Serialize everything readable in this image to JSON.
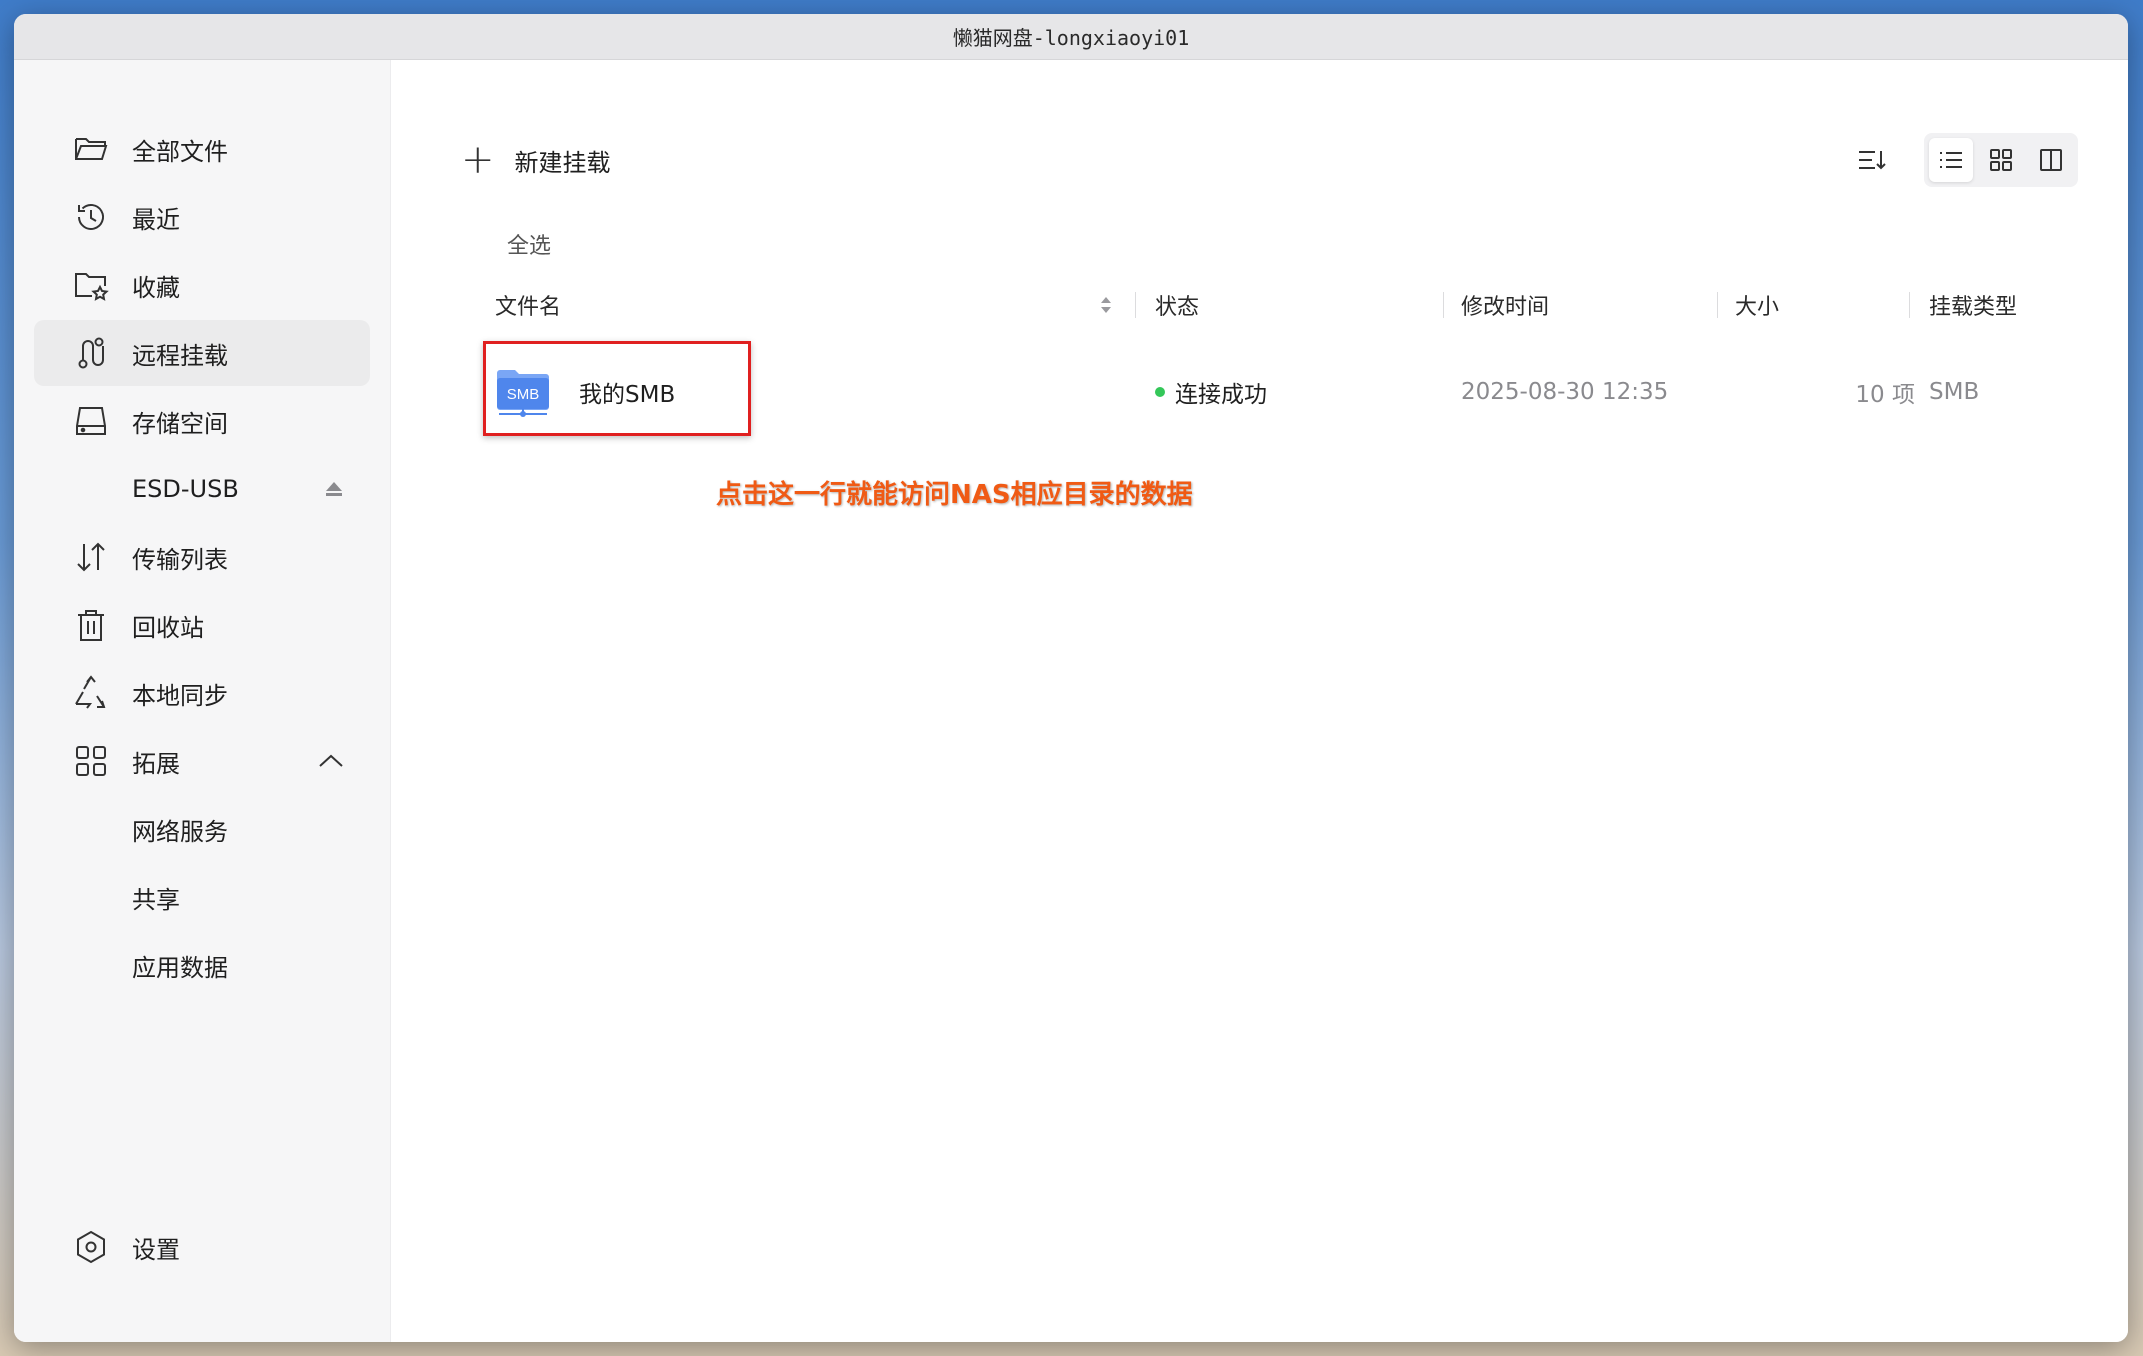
{
  "window": {
    "title": "懒猫网盘-longxiaoyi01"
  },
  "sidebar": {
    "items": [
      {
        "label": "全部文件",
        "icon": "folder-open-icon"
      },
      {
        "label": "最近",
        "icon": "history-icon"
      },
      {
        "label": "收藏",
        "icon": "folder-star-icon"
      },
      {
        "label": "远程挂载",
        "icon": "remote-mount-icon",
        "active": true
      },
      {
        "label": "存储空间",
        "icon": "hard-drive-icon"
      },
      {
        "label": "ESD-USB",
        "icon": "eject-icon"
      },
      {
        "label": "传输列表",
        "icon": "transfer-icon"
      },
      {
        "label": "回收站",
        "icon": "trash-icon"
      },
      {
        "label": "本地同步",
        "icon": "sync-icon"
      },
      {
        "label": "拓展",
        "icon": "grid-apps-icon"
      },
      {
        "label": "网络服务"
      },
      {
        "label": "共享"
      },
      {
        "label": "应用数据"
      }
    ],
    "settings": {
      "label": "设置",
      "icon": "settings-icon"
    }
  },
  "toolbar": {
    "new_mount_label": "新建挂载"
  },
  "list": {
    "select_all_label": "全选",
    "columns": {
      "name": "文件名",
      "status": "状态",
      "modified": "修改时间",
      "size": "大小",
      "mount_type": "挂载类型"
    },
    "rows": [
      {
        "icon_text": "SMB",
        "name": "我的SMB",
        "status": "连接成功",
        "modified": "2025-08-30 12:35",
        "size": "10 项",
        "mount_type": "SMB"
      }
    ]
  },
  "annotation": {
    "text": "点击这一行就能访问NAS相应目录的数据"
  },
  "colors": {
    "status_ok": "#34c759",
    "annotation": "#f05a14",
    "highlight": "#e02020",
    "smb_icon": "#5b8def"
  }
}
